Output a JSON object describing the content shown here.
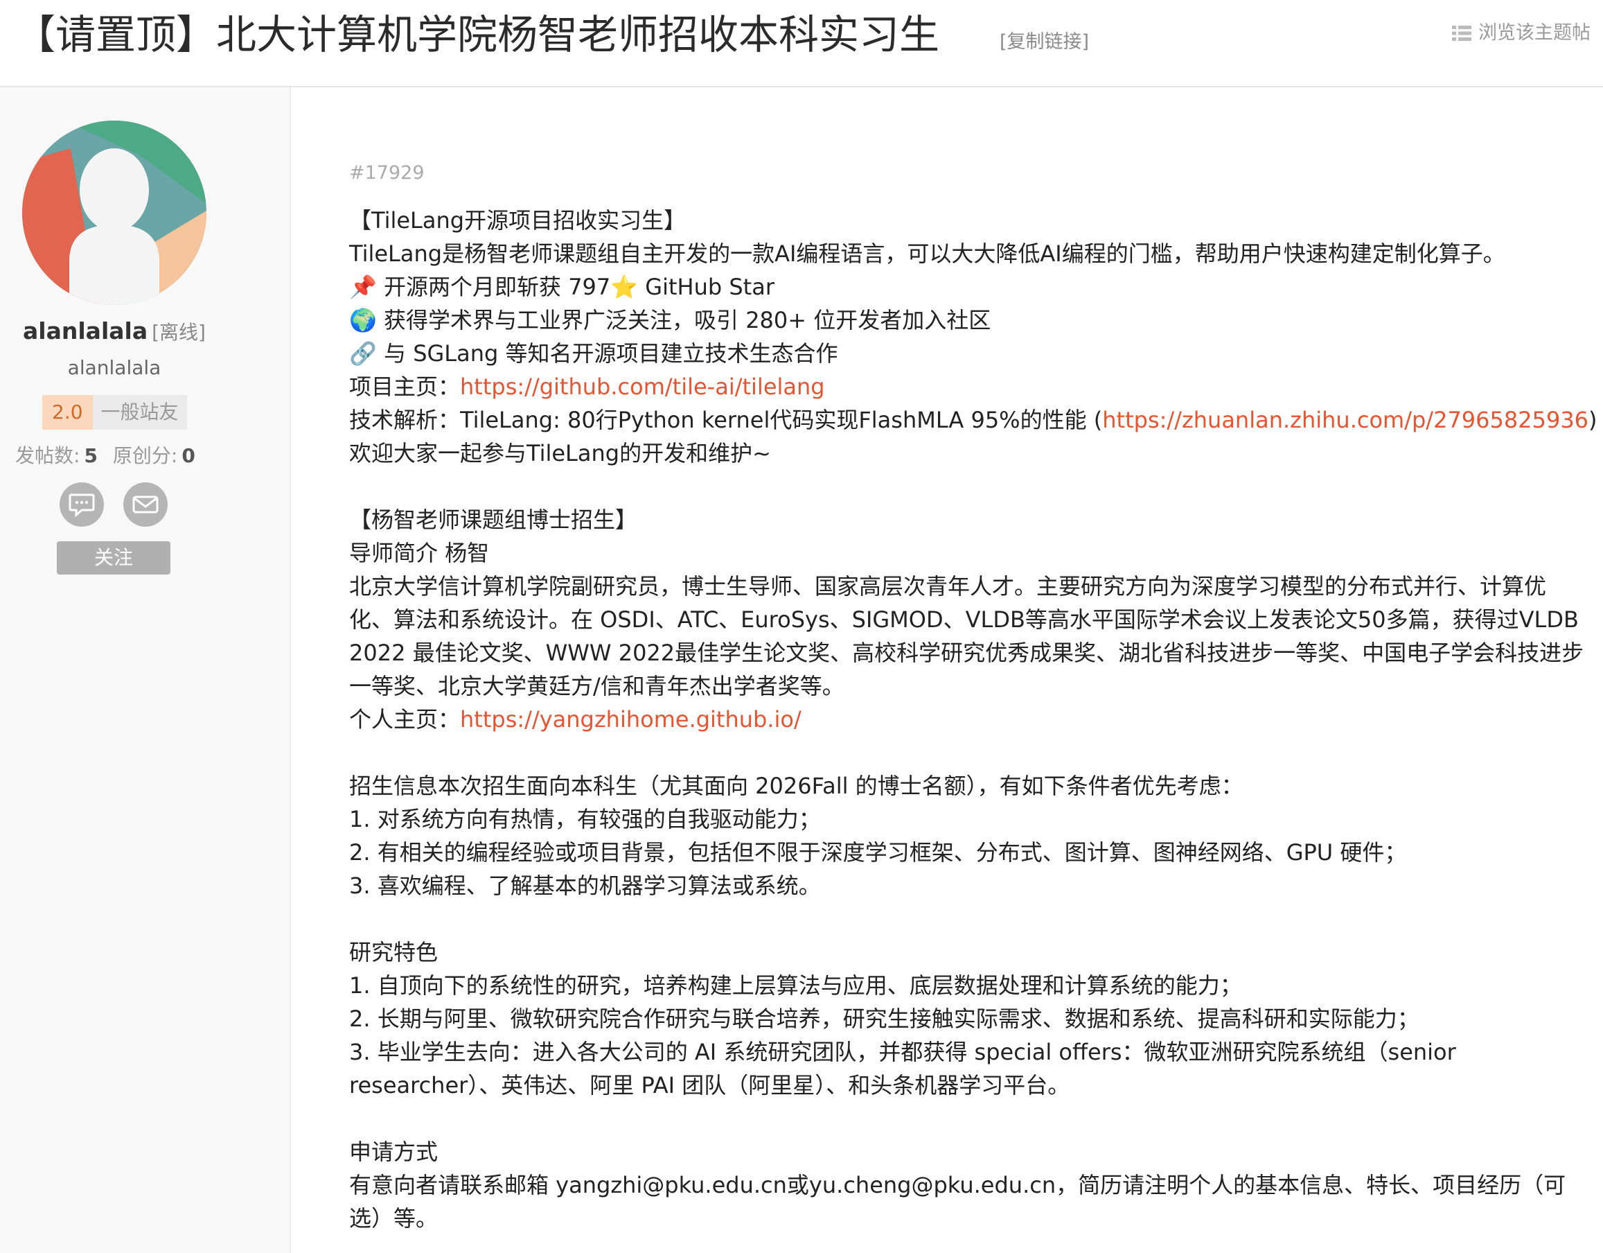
{
  "header": {
    "title": "【请置顶】北大计算机学院杨智老师招收本科实习生",
    "copy_link": "[复制链接]",
    "view_topic": "浏览该主题帖",
    "view_topic_icon": "list-icon"
  },
  "sidebar": {
    "avatar_icon": "default-avatar",
    "username": "alanlalala",
    "status": "[离线]",
    "handle": "alanlalala",
    "level": {
      "number": "2.0",
      "name": "一般站友"
    },
    "stats": {
      "posts_label": "发帖数:",
      "posts_value": "5",
      "original_label": "原创分:",
      "original_value": "0"
    },
    "chat_icon": "chat-icon",
    "mail_icon": "mail-icon",
    "follow_label": "关注"
  },
  "post": {
    "id": "#17929",
    "lines": {
      "l1": "【TileLang开源项目招收实习生】",
      "l2": "TileLang是杨智老师课题组自主开发的一款AI编程语言，可以大大降低AI编程的门槛，帮助用户快速构建定制化算子。",
      "l3": "📌 开源两个月即斩获 797⭐ GitHub Star",
      "l4": "🌍 获得学术界与工业界广泛关注，吸引 280+ 位开发者加入社区",
      "l5": "🔗 与 SGLang 等知名开源项目建立技术生态合作",
      "l6_label": "项目主页：",
      "l6_link": "https://github.com/tile-ai/tilelang",
      "l7_label": "技术解析：TileLang: 80行Python kernel代码实现FlashMLA 95%的性能 (",
      "l7_link": "https://zhuanlan.zhihu.com/p/27965825936",
      "l7_end": ")",
      "l8": "欢迎大家一起参与TileLang的开发和维护~",
      "l9": "【杨智老师课题组博士招生】",
      "l10": "导师简介 杨智",
      "l11": "北京大学信计算机学院副研究员，博士生导师、国家高层次青年人才。主要研究方向为深度学习模型的分布式并行、计算优化、算法和系统设计。在 OSDI、ATC、EuroSys、SIGMOD、VLDB等高水平国际学术会议上发表论文50多篇，获得过VLDB 2022 最佳论文奖、WWW 2022最佳学生论文奖、高校科学研究优秀成果奖、湖北省科技进步一等奖、中国电子学会科技进步一等奖、北京大学黄廷方/信和青年杰出学者奖等。",
      "l12_label": "个人主页：",
      "l12_link": "https://yangzhihome.github.io/",
      "l13": "招生信息本次招生面向本科生（尤其面向 2026Fall 的博士名额），有如下条件者优先考虑：",
      "l14": "1. 对系统方向有热情，有较强的自我驱动能力；",
      "l15": "2. 有相关的编程经验或项目背景，包括但不限于深度学习框架、分布式、图计算、图神经网络、GPU 硬件；",
      "l16": "3. 喜欢编程、了解基本的机器学习算法或系统。",
      "l17": "研究特色",
      "l18": "1. 自顶向下的系统性的研究，培养构建上层算法与应用、底层数据处理和计算系统的能力；",
      "l19": "2. 长期与阿里、微软研究院合作研究与联合培养，研究生接触实际需求、数据和系统、提高科研和实际能力；",
      "l20": "3. 毕业学生去向：进入各大公司的 AI 系统研究团队，并都获得 special offers：微软亚洲研究院系统组（senior researcher）、英伟达、阿里 PAI 团队（阿里星）、和头条机器学习平台。",
      "l21": "申请方式",
      "l22": "有意向者请联系邮箱 yangzhi@pku.edu.cn或yu.cheng@pku.edu.cn，简历请注明个人的基本信息、特长、项目经历（可选）等。"
    }
  },
  "colors": {
    "link": "#e8542f",
    "level_bg": "#fbd7bd",
    "level_text": "#d06a2a",
    "follow_bg": "#b0b0b0"
  }
}
